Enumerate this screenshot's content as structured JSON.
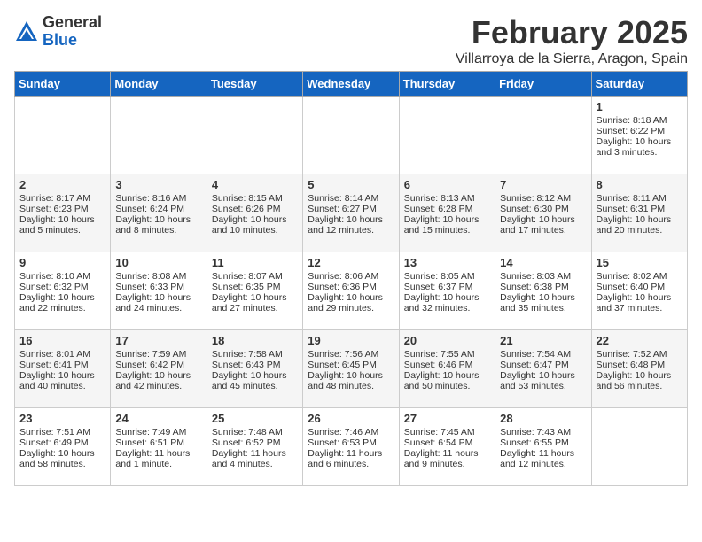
{
  "header": {
    "logo_general": "General",
    "logo_blue": "Blue",
    "month": "February 2025",
    "location": "Villarroya de la Sierra, Aragon, Spain"
  },
  "days_of_week": [
    "Sunday",
    "Monday",
    "Tuesday",
    "Wednesday",
    "Thursday",
    "Friday",
    "Saturday"
  ],
  "weeks": [
    [
      {
        "day": "",
        "info": ""
      },
      {
        "day": "",
        "info": ""
      },
      {
        "day": "",
        "info": ""
      },
      {
        "day": "",
        "info": ""
      },
      {
        "day": "",
        "info": ""
      },
      {
        "day": "",
        "info": ""
      },
      {
        "day": "1",
        "info": "Sunrise: 8:18 AM\nSunset: 6:22 PM\nDaylight: 10 hours and 3 minutes."
      }
    ],
    [
      {
        "day": "2",
        "info": "Sunrise: 8:17 AM\nSunset: 6:23 PM\nDaylight: 10 hours and 5 minutes."
      },
      {
        "day": "3",
        "info": "Sunrise: 8:16 AM\nSunset: 6:24 PM\nDaylight: 10 hours and 8 minutes."
      },
      {
        "day": "4",
        "info": "Sunrise: 8:15 AM\nSunset: 6:26 PM\nDaylight: 10 hours and 10 minutes."
      },
      {
        "day": "5",
        "info": "Sunrise: 8:14 AM\nSunset: 6:27 PM\nDaylight: 10 hours and 12 minutes."
      },
      {
        "day": "6",
        "info": "Sunrise: 8:13 AM\nSunset: 6:28 PM\nDaylight: 10 hours and 15 minutes."
      },
      {
        "day": "7",
        "info": "Sunrise: 8:12 AM\nSunset: 6:30 PM\nDaylight: 10 hours and 17 minutes."
      },
      {
        "day": "8",
        "info": "Sunrise: 8:11 AM\nSunset: 6:31 PM\nDaylight: 10 hours and 20 minutes."
      }
    ],
    [
      {
        "day": "9",
        "info": "Sunrise: 8:10 AM\nSunset: 6:32 PM\nDaylight: 10 hours and 22 minutes."
      },
      {
        "day": "10",
        "info": "Sunrise: 8:08 AM\nSunset: 6:33 PM\nDaylight: 10 hours and 24 minutes."
      },
      {
        "day": "11",
        "info": "Sunrise: 8:07 AM\nSunset: 6:35 PM\nDaylight: 10 hours and 27 minutes."
      },
      {
        "day": "12",
        "info": "Sunrise: 8:06 AM\nSunset: 6:36 PM\nDaylight: 10 hours and 29 minutes."
      },
      {
        "day": "13",
        "info": "Sunrise: 8:05 AM\nSunset: 6:37 PM\nDaylight: 10 hours and 32 minutes."
      },
      {
        "day": "14",
        "info": "Sunrise: 8:03 AM\nSunset: 6:38 PM\nDaylight: 10 hours and 35 minutes."
      },
      {
        "day": "15",
        "info": "Sunrise: 8:02 AM\nSunset: 6:40 PM\nDaylight: 10 hours and 37 minutes."
      }
    ],
    [
      {
        "day": "16",
        "info": "Sunrise: 8:01 AM\nSunset: 6:41 PM\nDaylight: 10 hours and 40 minutes."
      },
      {
        "day": "17",
        "info": "Sunrise: 7:59 AM\nSunset: 6:42 PM\nDaylight: 10 hours and 42 minutes."
      },
      {
        "day": "18",
        "info": "Sunrise: 7:58 AM\nSunset: 6:43 PM\nDaylight: 10 hours and 45 minutes."
      },
      {
        "day": "19",
        "info": "Sunrise: 7:56 AM\nSunset: 6:45 PM\nDaylight: 10 hours and 48 minutes."
      },
      {
        "day": "20",
        "info": "Sunrise: 7:55 AM\nSunset: 6:46 PM\nDaylight: 10 hours and 50 minutes."
      },
      {
        "day": "21",
        "info": "Sunrise: 7:54 AM\nSunset: 6:47 PM\nDaylight: 10 hours and 53 minutes."
      },
      {
        "day": "22",
        "info": "Sunrise: 7:52 AM\nSunset: 6:48 PM\nDaylight: 10 hours and 56 minutes."
      }
    ],
    [
      {
        "day": "23",
        "info": "Sunrise: 7:51 AM\nSunset: 6:49 PM\nDaylight: 10 hours and 58 minutes."
      },
      {
        "day": "24",
        "info": "Sunrise: 7:49 AM\nSunset: 6:51 PM\nDaylight: 11 hours and 1 minute."
      },
      {
        "day": "25",
        "info": "Sunrise: 7:48 AM\nSunset: 6:52 PM\nDaylight: 11 hours and 4 minutes."
      },
      {
        "day": "26",
        "info": "Sunrise: 7:46 AM\nSunset: 6:53 PM\nDaylight: 11 hours and 6 minutes."
      },
      {
        "day": "27",
        "info": "Sunrise: 7:45 AM\nSunset: 6:54 PM\nDaylight: 11 hours and 9 minutes."
      },
      {
        "day": "28",
        "info": "Sunrise: 7:43 AM\nSunset: 6:55 PM\nDaylight: 11 hours and 12 minutes."
      },
      {
        "day": "",
        "info": ""
      }
    ]
  ]
}
